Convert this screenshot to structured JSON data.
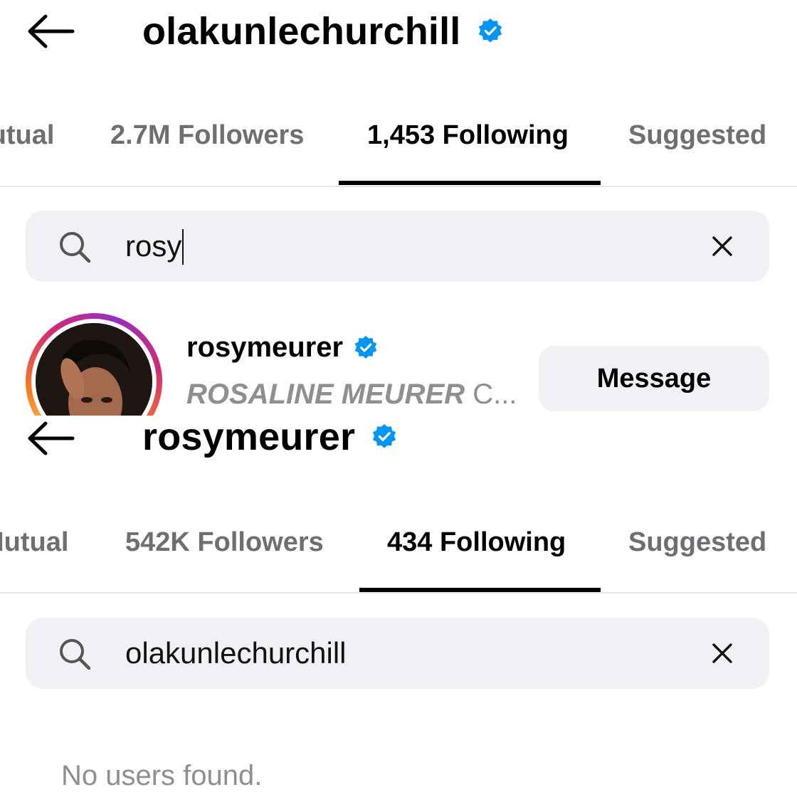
{
  "top": {
    "header": {
      "title": "olakunlechurchill",
      "verified": true
    },
    "tabs": [
      "Mutual",
      "2.7M Followers",
      "1,453 Following",
      "Suggested"
    ],
    "active_tab": "1,453 Following",
    "search": {
      "value": "rosy",
      "focused": true
    },
    "results": [
      {
        "username": "rosymeurer",
        "verified": true,
        "subtitle": "ROSALINE MEURER",
        "subtitle_tail": "C...",
        "action_label": "Message"
      }
    ]
  },
  "bottom": {
    "header": {
      "title": "rosymeurer",
      "verified": true
    },
    "tabs": [
      "Mutual",
      "542K Followers",
      "434 Following",
      "Suggested"
    ],
    "active_tab": "434 Following",
    "search": {
      "value": "olakunlechurchill"
    },
    "empty_state": "No users found."
  },
  "colors": {
    "verified_blue": "#0095f6",
    "active_text": "#000000",
    "inactive_text": "#6e6e73",
    "search_bg": "#eff1f4",
    "muted_text": "#8e8e93",
    "story_ring": [
      "#feda75",
      "#fa7e1e",
      "#d62976",
      "#962fbf"
    ]
  },
  "icons": {
    "back": "arrow-left-icon",
    "verified": "verified-badge-icon",
    "search": "search-icon",
    "clear": "close-icon"
  }
}
